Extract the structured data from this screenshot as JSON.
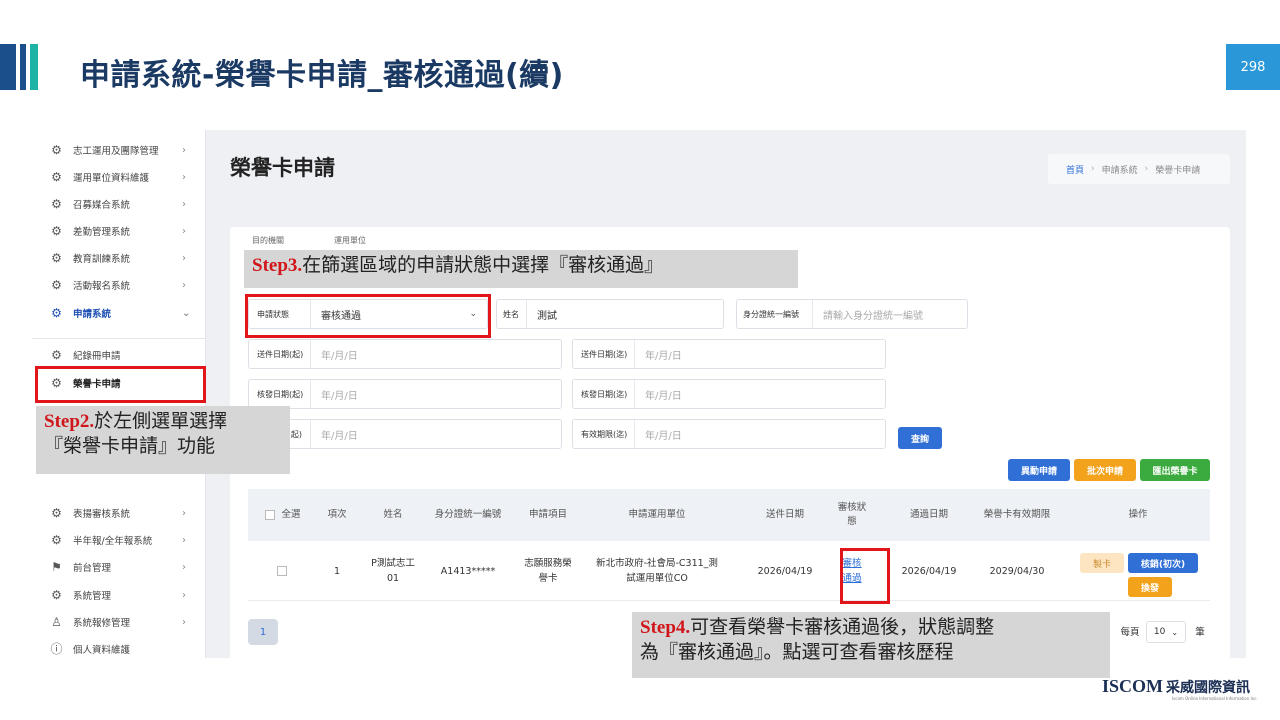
{
  "slide": {
    "title": "申請系統-榮譽卡申請_審核通過(續)",
    "page_number": "298"
  },
  "sidebar": {
    "items": [
      {
        "label": "志工運用及團隊管理",
        "icon": "gear-icon"
      },
      {
        "label": "運用單位資料維護",
        "icon": "gear-icon"
      },
      {
        "label": "召募媒合系統",
        "icon": "gear-icon"
      },
      {
        "label": "差勤管理系統",
        "icon": "gear-icon"
      },
      {
        "label": "教育訓練系統",
        "icon": "gear-icon"
      },
      {
        "label": "活動報名系統",
        "icon": "gear-icon"
      },
      {
        "label": "申請系統",
        "icon": "gear-icon"
      },
      {
        "label": "紀錄冊申請",
        "icon": "gear-icon"
      },
      {
        "label": "榮譽卡申請",
        "icon": "gear-icon"
      },
      {
        "label": "表揚審核系統",
        "icon": "gear-icon"
      },
      {
        "label": "半年報/全年報系統",
        "icon": "gear-icon"
      },
      {
        "label": "前台管理",
        "icon": "sign-icon"
      },
      {
        "label": "系統管理",
        "icon": "gear-icon"
      },
      {
        "label": "系統報修管理",
        "icon": "user-icon"
      },
      {
        "label": "個人資料維護",
        "icon": "info-icon"
      }
    ]
  },
  "main": {
    "title": "榮譽卡申請",
    "breadcrumb": {
      "home": "首頁",
      "sep": "›",
      "level1": "申請系統",
      "level2": "榮譽卡申請"
    }
  },
  "filters": {
    "top_labels": {
      "agency": "目的機關",
      "unit": "運用單位"
    },
    "status": {
      "label": "申請狀態",
      "value": "審核通過",
      "caret": "⌄"
    },
    "name": {
      "label": "姓名",
      "value": "測試"
    },
    "id": {
      "label": "身分證統一編號",
      "placeholder": "請輸入身分證統一編號"
    },
    "send_start": {
      "label": "送件日期(起)",
      "placeholder": "年/月/日"
    },
    "send_end": {
      "label": "送件日期(迄)",
      "placeholder": "年/月/日"
    },
    "issue_start": {
      "label": "核發日期(起)",
      "placeholder": "年/月/日"
    },
    "issue_end": {
      "label": "核發日期(迄)",
      "placeholder": "年/月/日"
    },
    "valid_start": {
      "label": "(起)",
      "placeholder": "年/月/日"
    },
    "valid_end": {
      "label": "有效期限(迄)",
      "placeholder": "年/月/日"
    },
    "query_button": "查詢"
  },
  "actions": {
    "apply": "異動申請",
    "batch": "批次申請",
    "export": "匯出榮譽卡",
    "colors": {
      "blue": "#2f6fd6",
      "orange": "#f3a21c",
      "green": "#3cab3f"
    }
  },
  "table": {
    "headers": [
      "全選",
      "項次",
      "姓名",
      "身分證統一編號",
      "申請項目",
      "申請運用單位",
      "送件日期",
      "審核狀態",
      "通過日期",
      "榮譽卡有效期限",
      "操作"
    ],
    "rows": [
      {
        "index": "1",
        "name": "P測試志工01",
        "id": "A1413*****",
        "item": "志願服務榮譽卡",
        "unit": "新北市政府-社會局-C311_測試運用單位CO",
        "send_date": "2026/04/19",
        "status": "審核通過",
        "pass_date": "2026/04/19",
        "valid_until": "2029/04/30",
        "ops": {
          "card": "製卡",
          "verify": "核銷(初次)",
          "renew": "換發"
        }
      }
    ]
  },
  "pagination": {
    "page": "1",
    "right_text": "每頁",
    "per_page": "10",
    "unit": "筆"
  },
  "callouts": {
    "step3_tag": "Step3.",
    "step3_text": "在篩選區域的申請狀態中選擇『審核通過』",
    "step2_tag": "Step2.",
    "step2_line1": "於左側選單選擇",
    "step2_line2": "『榮譽卡申請』功能",
    "step4_tag": "Step4.",
    "step4_line1": "可查看榮譽卡審核通過後，狀態調整",
    "step4_line2": "為『審核通過』。點選可查看審核歷程"
  },
  "logo": {
    "en": "ISCOM",
    "zh": "采威國際資訊",
    "sub": "Iscom Online International Information Inc."
  }
}
